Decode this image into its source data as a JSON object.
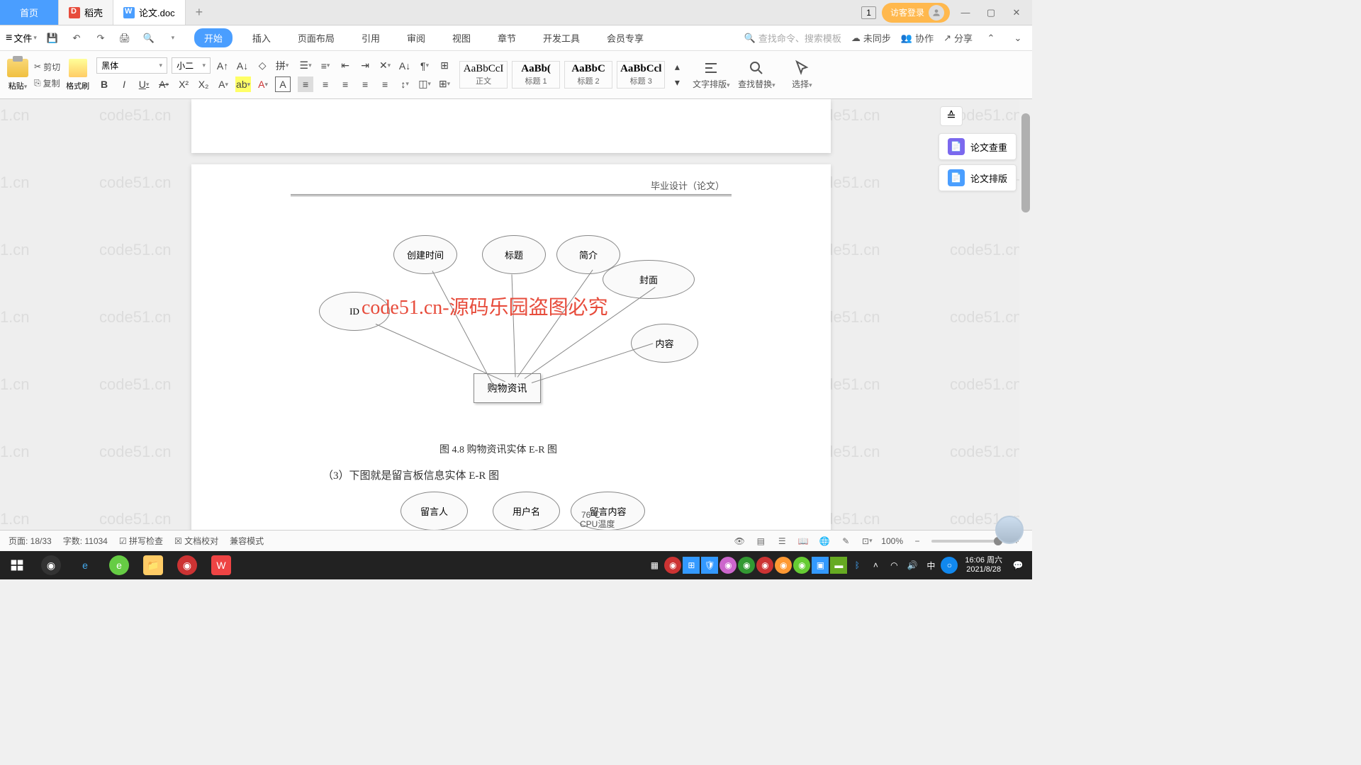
{
  "tabs": {
    "home": "首页",
    "daoke": "稻壳",
    "doc": "论文.doc"
  },
  "tabsRight": {
    "num": "1",
    "login": "访客登录"
  },
  "menu": {
    "file": "文件",
    "tabs": [
      "开始",
      "插入",
      "页面布局",
      "引用",
      "审阅",
      "视图",
      "章节",
      "开发工具",
      "会员专享"
    ],
    "search": "查找命令、搜索模板",
    "unsync": "未同步",
    "collab": "协作",
    "share": "分享"
  },
  "ribbon": {
    "paste": "粘贴",
    "cut": "剪切",
    "copy": "复制",
    "fmtbrush": "格式刷",
    "font": "黑体",
    "size": "小二",
    "styles": [
      {
        "prev": "AaBbCcI",
        "name": "正文"
      },
      {
        "prev": "AaBb(",
        "name": "标题 1",
        "bold": true
      },
      {
        "prev": "AaBbC",
        "name": "标题 2",
        "bold": true
      },
      {
        "prev": "AaBbCcl",
        "name": "标题 3",
        "bold": true
      }
    ],
    "textlayout": "文字排版",
    "findreplace": "查找替换",
    "select": "选择"
  },
  "sidepanel": {
    "check": "论文查重",
    "layout": "论文排版"
  },
  "doc": {
    "header": "毕业设计（论文）",
    "diagram": {
      "entity": "购物资讯",
      "attrs": [
        "ID",
        "创建时间",
        "标题",
        "简介",
        "封面",
        "内容"
      ],
      "caption": "图 4.8  购物资讯实体 E-R 图"
    },
    "line3": "（3）下图就是留言板信息实体 E-R 图",
    "diagram2": {
      "attrs": [
        "留言人",
        "用户名",
        "留言内容"
      ]
    },
    "redwm": "code51.cn-源码乐园盗图必究",
    "wm": "code51.cn"
  },
  "status": {
    "page": "页面: 18/33",
    "words": "字数: 11034",
    "spell": "拼写检查",
    "proof": "文档校对",
    "compat": "兼容模式",
    "zoom": "100%",
    "cputemp": "CPU温度",
    "temp": "76℃"
  },
  "clock": {
    "time": "16:06",
    "day": "周六",
    "date": "2021/8/28"
  },
  "ime": "中"
}
